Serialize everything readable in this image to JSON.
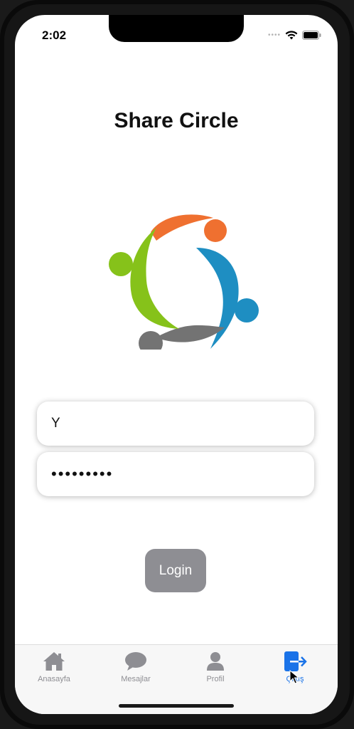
{
  "status_bar": {
    "time": "2:02"
  },
  "app": {
    "title": "Share Circle"
  },
  "login_form": {
    "username_value": "Y",
    "password_value": "•••••••••",
    "login_label": "Login"
  },
  "tabbar": {
    "items": [
      {
        "label": "Anasayfa",
        "icon": "home-icon"
      },
      {
        "label": "Mesajlar",
        "icon": "chat-bubble-icon"
      },
      {
        "label": "Profil",
        "icon": "person-icon"
      },
      {
        "label": "Çıkış",
        "icon": "logout-icon",
        "active": true
      }
    ]
  },
  "colors": {
    "logo_orange": "#ef7030",
    "logo_blue": "#1e8ec2",
    "logo_gray": "#737373",
    "logo_green": "#86c21a",
    "active_tab": "#1a73e8",
    "login_button": "#8e8e93"
  }
}
